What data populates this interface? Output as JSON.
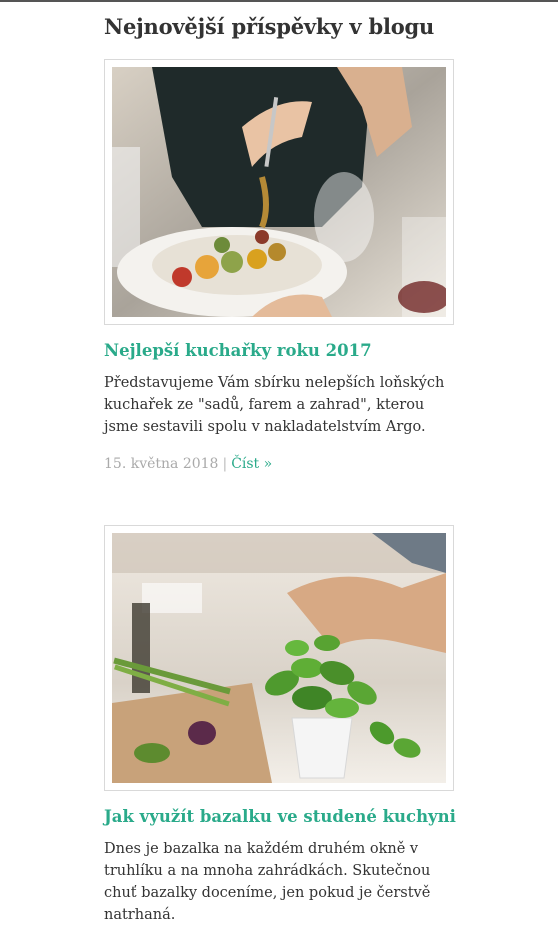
{
  "section": {
    "title": "Nejnovější příspěvky v blogu"
  },
  "posts": [
    {
      "title": "Nejlepší kuchařky roku 2017",
      "excerpt": "Představujeme Vám sbírku nelepších loňských kuchařek ze \"sadů, farem a zahrad\", kterou jsme sestavili spolu v nakladatelstvím Argo.",
      "date": "15. května 2018",
      "separator": "|",
      "read_more": "Číst »",
      "image_icon": "food-plate-photo"
    },
    {
      "title": "Jak využít bazalku ve studené kuchyni",
      "excerpt": "Dnes je bazalka na každém druhém okně v truhlíku a na mnoha zahrádkách. Skutečnou chuť bazalky doceníme, jen pokud je čerstvě natrhaná.",
      "image_icon": "basil-pot-photo"
    }
  ]
}
